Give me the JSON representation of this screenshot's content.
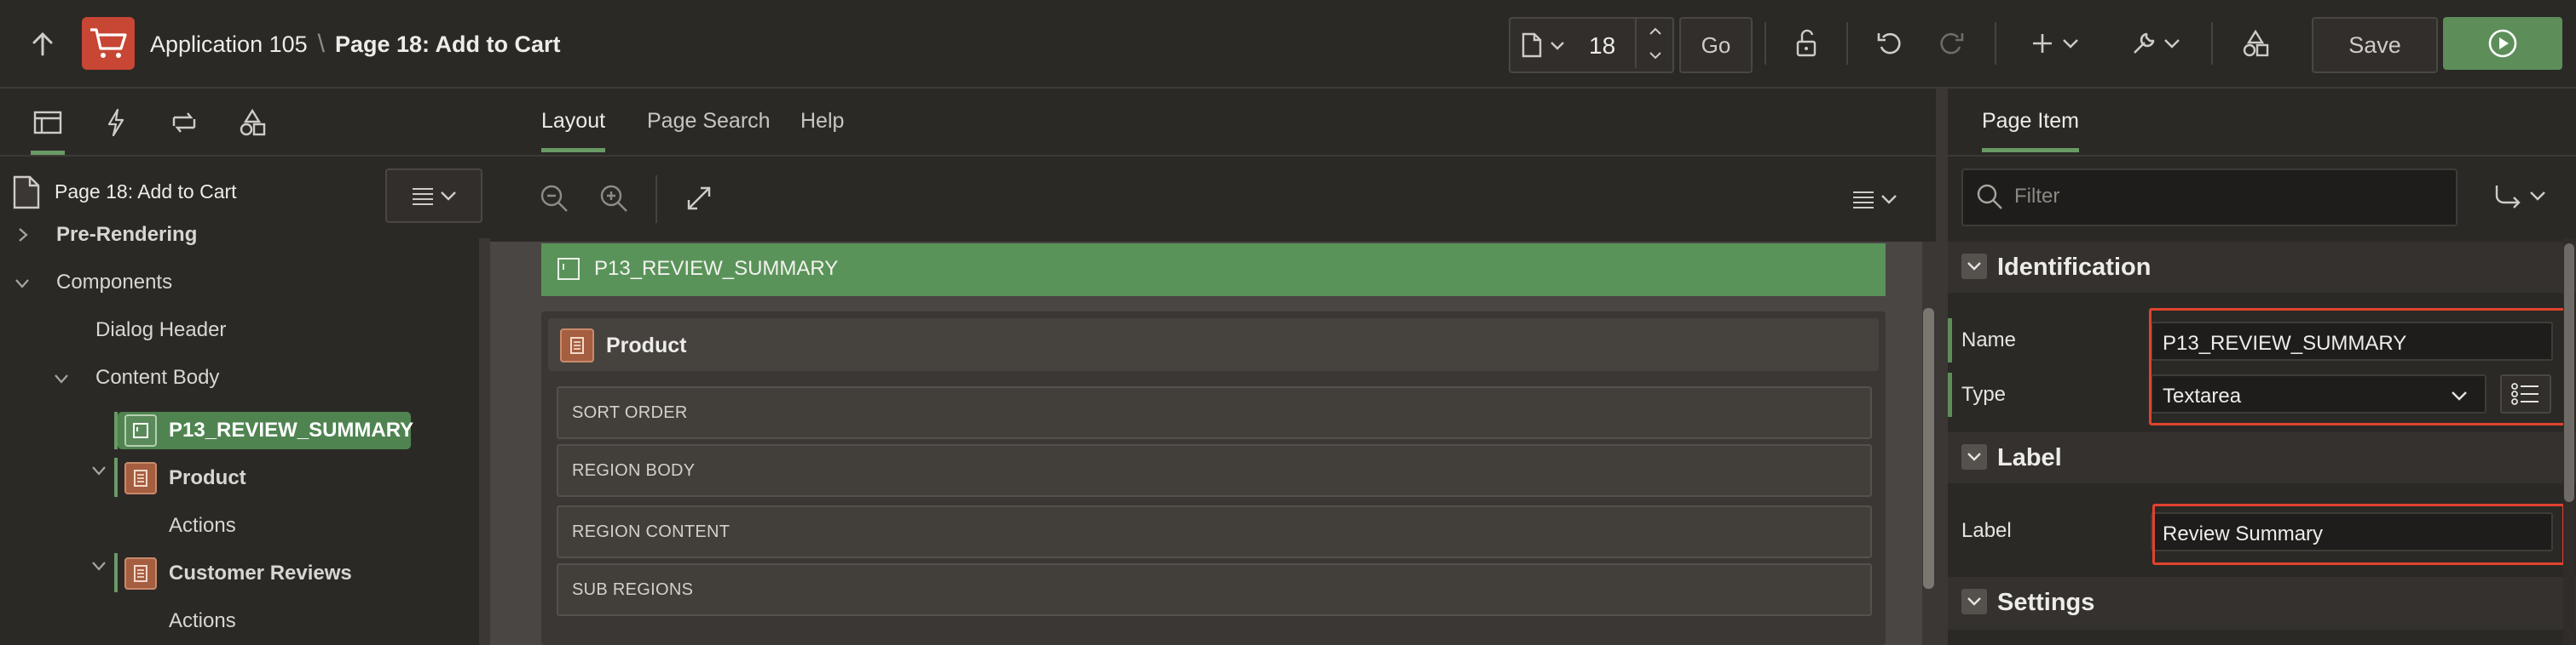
{
  "header": {
    "app_name": "Application 105",
    "separator": "\\",
    "page_title": "Page 18: Add to Cart",
    "page_number": "18",
    "go_label": "Go",
    "save_label": "Save"
  },
  "left": {
    "tree_title": "Page 18: Add to Cart",
    "tree": [
      {
        "label": "Pre-Rendering"
      },
      {
        "label": "Components"
      },
      {
        "label": "Dialog Header"
      },
      {
        "label": "Content Body"
      },
      {
        "label": "P13_REVIEW_SUMMARY"
      },
      {
        "label": "Product"
      },
      {
        "label": "Actions"
      },
      {
        "label": "Customer Reviews"
      },
      {
        "label": "Actions"
      }
    ]
  },
  "center": {
    "tabs": [
      {
        "label": "Layout"
      },
      {
        "label": "Page Search"
      },
      {
        "label": "Help"
      }
    ],
    "canvas_item": "P13_REVIEW_SUMMARY",
    "region_title": "Product",
    "slots": [
      "SORT ORDER",
      "REGION BODY",
      "REGION CONTENT",
      "SUB REGIONS"
    ]
  },
  "right": {
    "tab": "Page Item",
    "filter_placeholder": "Filter",
    "groups": {
      "identification": "Identification",
      "label": "Label",
      "settings": "Settings"
    },
    "props": {
      "name_label": "Name",
      "name_value": "P13_REVIEW_SUMMARY",
      "type_label": "Type",
      "type_value": "Textarea",
      "label_label": "Label",
      "label_value": "Review Summary"
    },
    "highlight_color": "#e0432f"
  },
  "colors": {
    "accent_green": "#5d8e5a",
    "brand_red": "#c74634",
    "background": "#2b2926"
  }
}
